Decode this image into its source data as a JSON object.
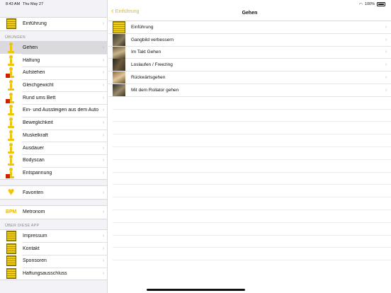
{
  "status": {
    "time": "8:43 AM",
    "date": "Thu May 27",
    "battery": "100%"
  },
  "sidebar": {
    "top_items": [
      {
        "label": "Einführung",
        "icon": "info-box-icon"
      }
    ],
    "section_uebungen": "ÜBUNGEN",
    "uebungen": [
      {
        "label": "Gehen",
        "icon": "walking-figure-icon",
        "selected": true
      },
      {
        "label": "Haltung",
        "icon": "posture-figure-icon"
      },
      {
        "label": "Aufstehen",
        "icon": "stand-up-figure-icon"
      },
      {
        "label": "Gleichgewicht",
        "icon": "balance-figure-icon"
      },
      {
        "label": "Rund ums Bett",
        "icon": "bed-figure-icon"
      },
      {
        "label": "Ein- und Aussteigen aus dem Auto",
        "icon": "car-figure-icon"
      },
      {
        "label": "Beweglichkeit",
        "icon": "mobility-figure-icon"
      },
      {
        "label": "Muskelkraft",
        "icon": "strength-figure-icon"
      },
      {
        "label": "Ausdauer",
        "icon": "endurance-figure-icon"
      },
      {
        "label": "Bodyscan",
        "icon": "bodyscan-figure-icon"
      },
      {
        "label": "Entspannung",
        "icon": "relax-figure-icon"
      }
    ],
    "favoriten": {
      "label": "Favoriten",
      "icon": "heart-icon"
    },
    "metronom": {
      "label": "Metronom",
      "icon_text": "BPM"
    },
    "section_app": "ÜBER DIESE APP",
    "app_items": [
      {
        "label": "Impressum",
        "icon": "info-box-icon"
      },
      {
        "label": "Kontakt",
        "icon": "info-box-icon"
      },
      {
        "label": "Sponsoren",
        "icon": "info-box-icon"
      },
      {
        "label": "Haftungsausschluss",
        "icon": "info-box-icon"
      }
    ],
    "chevron": "›"
  },
  "detail": {
    "back_label": "Einführung",
    "title": "Gehen",
    "items": [
      {
        "label": "Einführung",
        "thumb": "box"
      },
      {
        "label": "Gangbild verbessern",
        "thumb": "photo1"
      },
      {
        "label": "Im Takt Gehen",
        "thumb": "photo2"
      },
      {
        "label": "Loslaufen / Freezing",
        "thumb": "photo3"
      },
      {
        "label": "Rückwärtsgehen",
        "thumb": "photo4"
      },
      {
        "label": "Mit dem Rollator gehen",
        "thumb": "photo5"
      }
    ]
  },
  "colors": {
    "accent": "#e6b800",
    "selected_row": "#d9d9de",
    "sidebar_bg": "#f2f2f7"
  }
}
